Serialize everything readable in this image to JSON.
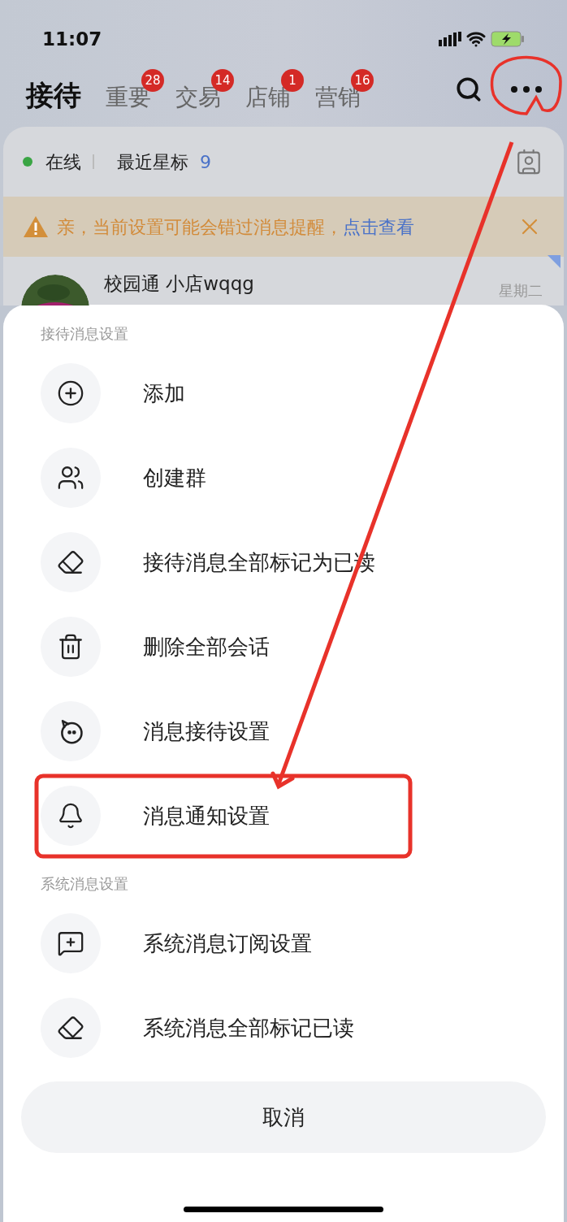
{
  "status_bar": {
    "time": "11:07"
  },
  "header": {
    "tabs": [
      {
        "label": "接待",
        "selected": true
      },
      {
        "label": "重要",
        "badge": "28",
        "selected": false
      },
      {
        "label": "交易",
        "badge": "14",
        "selected": false
      },
      {
        "label": "店铺",
        "badge": "1",
        "selected": false
      },
      {
        "label": "营销",
        "badge": "16",
        "selected": false
      }
    ]
  },
  "status_row": {
    "online": "在线",
    "starred_label": "最近星标",
    "starred_count": "9"
  },
  "notice": {
    "text": "亲，当前设置可能会错过消息提醒，",
    "link": "点击查看"
  },
  "conversation": {
    "name": "校园通 小店wqqg",
    "time": "星期二"
  },
  "sheet": {
    "sections": [
      {
        "title": "接待消息设置",
        "items": [
          {
            "label": "添加"
          },
          {
            "label": "创建群"
          },
          {
            "label": "接待消息全部标记为已读"
          },
          {
            "label": "删除全部会话"
          },
          {
            "label": "消息接待设置"
          },
          {
            "label": "消息通知设置"
          }
        ]
      },
      {
        "title": "系统消息设置",
        "items": [
          {
            "label": "系统消息订阅设置"
          },
          {
            "label": "系统消息全部标记已读"
          }
        ]
      }
    ],
    "cancel": "取消"
  }
}
